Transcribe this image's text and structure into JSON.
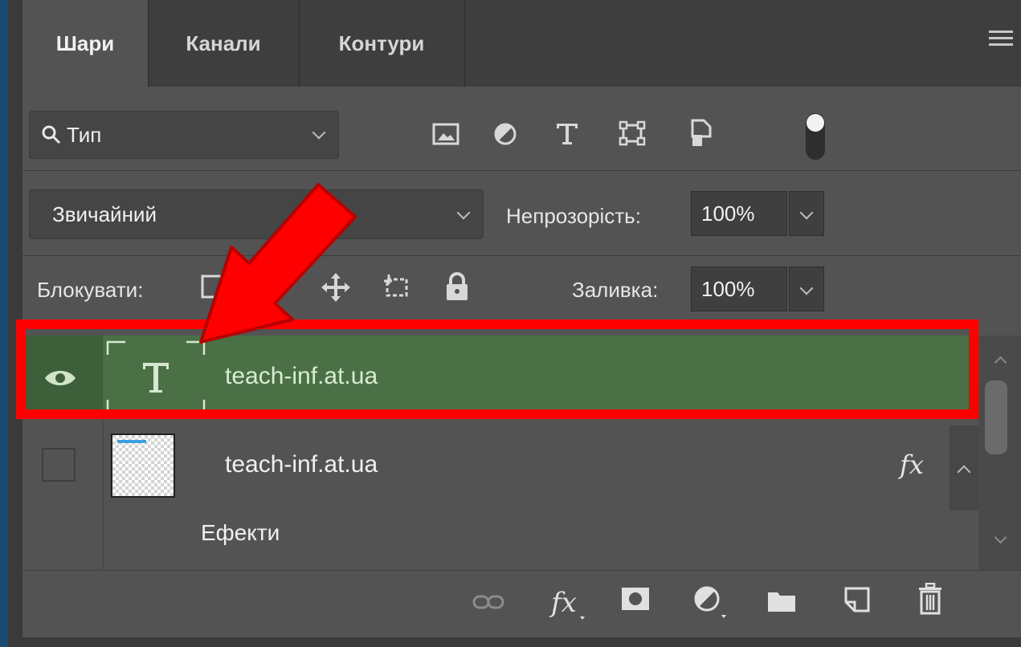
{
  "tabs": [
    {
      "label": "Шари",
      "active": true
    },
    {
      "label": "Канали",
      "active": false
    },
    {
      "label": "Контури",
      "active": false
    }
  ],
  "filter": {
    "label": "Тип",
    "icons": [
      "image-filter-icon",
      "adjustment-filter-icon",
      "type-filter-icon",
      "shape-filter-icon",
      "smart-object-filter-icon",
      "filter-toggle-icon"
    ]
  },
  "blend": {
    "mode": "Звичайний",
    "opacity_label": "Непрозорість:",
    "opacity_value": "100%"
  },
  "lock": {
    "label": "Блокувати:",
    "fill_label": "Заливка:",
    "fill_value": "100%",
    "icons": [
      "lock-transparent-icon",
      "lock-paint-icon",
      "lock-position-icon",
      "lock-artboard-icon",
      "lock-all-icon"
    ]
  },
  "layers": [
    {
      "name": "teach-inf.at.ua",
      "type": "text",
      "selected": true,
      "visible": true
    },
    {
      "name": "teach-inf.at.ua",
      "type": "pixel",
      "selected": false,
      "visible": false,
      "fx": "fx",
      "effects_label": "Ефекти"
    }
  ],
  "bottom_icons": [
    "link-layers-icon",
    "fx-icon",
    "add-mask-icon",
    "adjustment-layer-icon",
    "new-group-icon",
    "new-layer-icon",
    "delete-layer-icon"
  ],
  "colors": {
    "panel": "#535353",
    "selected_layer": "#4b7046",
    "annotation": "#ff0000"
  }
}
